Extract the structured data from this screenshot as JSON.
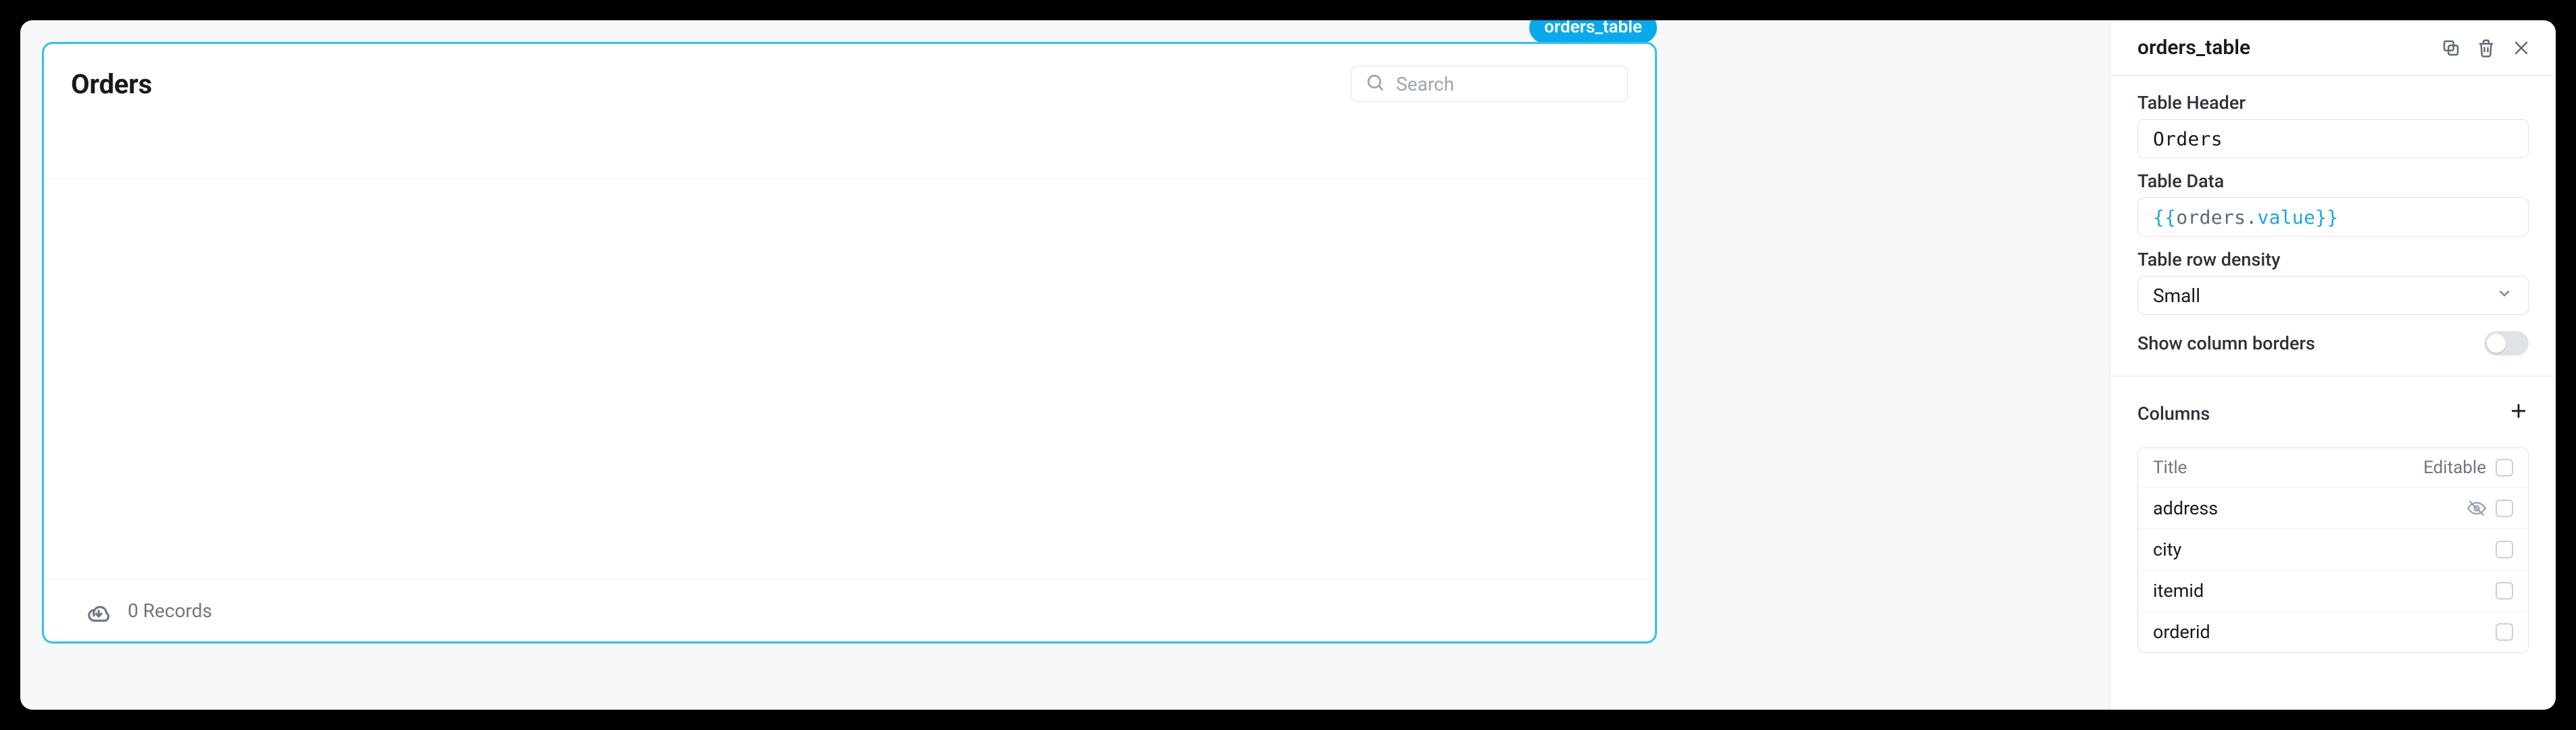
{
  "widget": {
    "tag": "orders_table",
    "title": "Orders",
    "search_placeholder": "Search",
    "records_text": "0 Records"
  },
  "inspector": {
    "title": "orders_table",
    "section_header": {
      "label": "Table Header",
      "value": "Orders"
    },
    "section_data": {
      "label": "Table Data",
      "value_parts": {
        "open": "{{",
        "object": "orders",
        "dot": ".",
        "prop": "value",
        "close": "}}"
      }
    },
    "section_density": {
      "label": "Table row density",
      "value": "Small"
    },
    "section_borders": {
      "label": "Show column borders",
      "on": false
    },
    "columns_section": {
      "label": "Columns",
      "head_title": "Title",
      "head_editable": "Editable",
      "items": [
        {
          "title": "address",
          "hidden": true
        },
        {
          "title": "city",
          "hidden": false
        },
        {
          "title": "itemid",
          "hidden": false
        },
        {
          "title": "orderid",
          "hidden": false
        }
      ]
    }
  }
}
